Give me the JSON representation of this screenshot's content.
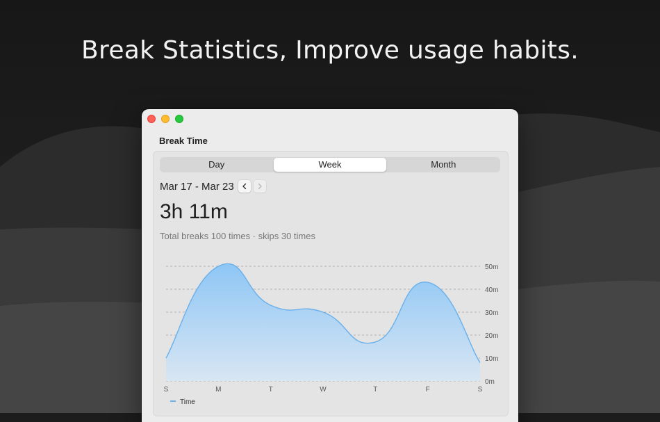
{
  "headline": "Break Statistics, Improve usage habits.",
  "window": {
    "title": "Break Time",
    "traffic_lights": [
      "close",
      "minimize",
      "zoom"
    ]
  },
  "tabs": [
    {
      "label": "Day",
      "active": false
    },
    {
      "label": "Week",
      "active": true
    },
    {
      "label": "Month",
      "active": false
    }
  ],
  "date_range": "Mar 17 - Mar 23",
  "prev_icon": "chevron-left-icon",
  "next_icon": "chevron-right-icon",
  "total_time": "3h 11m",
  "summary": "Total breaks 100 times · skips 30 times",
  "colors": {
    "line": "#6ab0ea",
    "fill_top": "#8ec6f5",
    "fill_bottom": "#d8e6f3",
    "grid": "#a0a0a0"
  },
  "chart_data": {
    "type": "area",
    "categories": [
      "S",
      "M",
      "T",
      "W",
      "T",
      "F",
      "S"
    ],
    "series": [
      {
        "name": "Time",
        "values": [
          10,
          50,
          33,
          30,
          17,
          43,
          8
        ]
      }
    ],
    "y_ticks": [
      "0m",
      "10m",
      "20m",
      "30m",
      "40m",
      "50m"
    ],
    "ylim": [
      0,
      50
    ],
    "grid": true,
    "smooth": true,
    "legend": "bottom-left"
  }
}
